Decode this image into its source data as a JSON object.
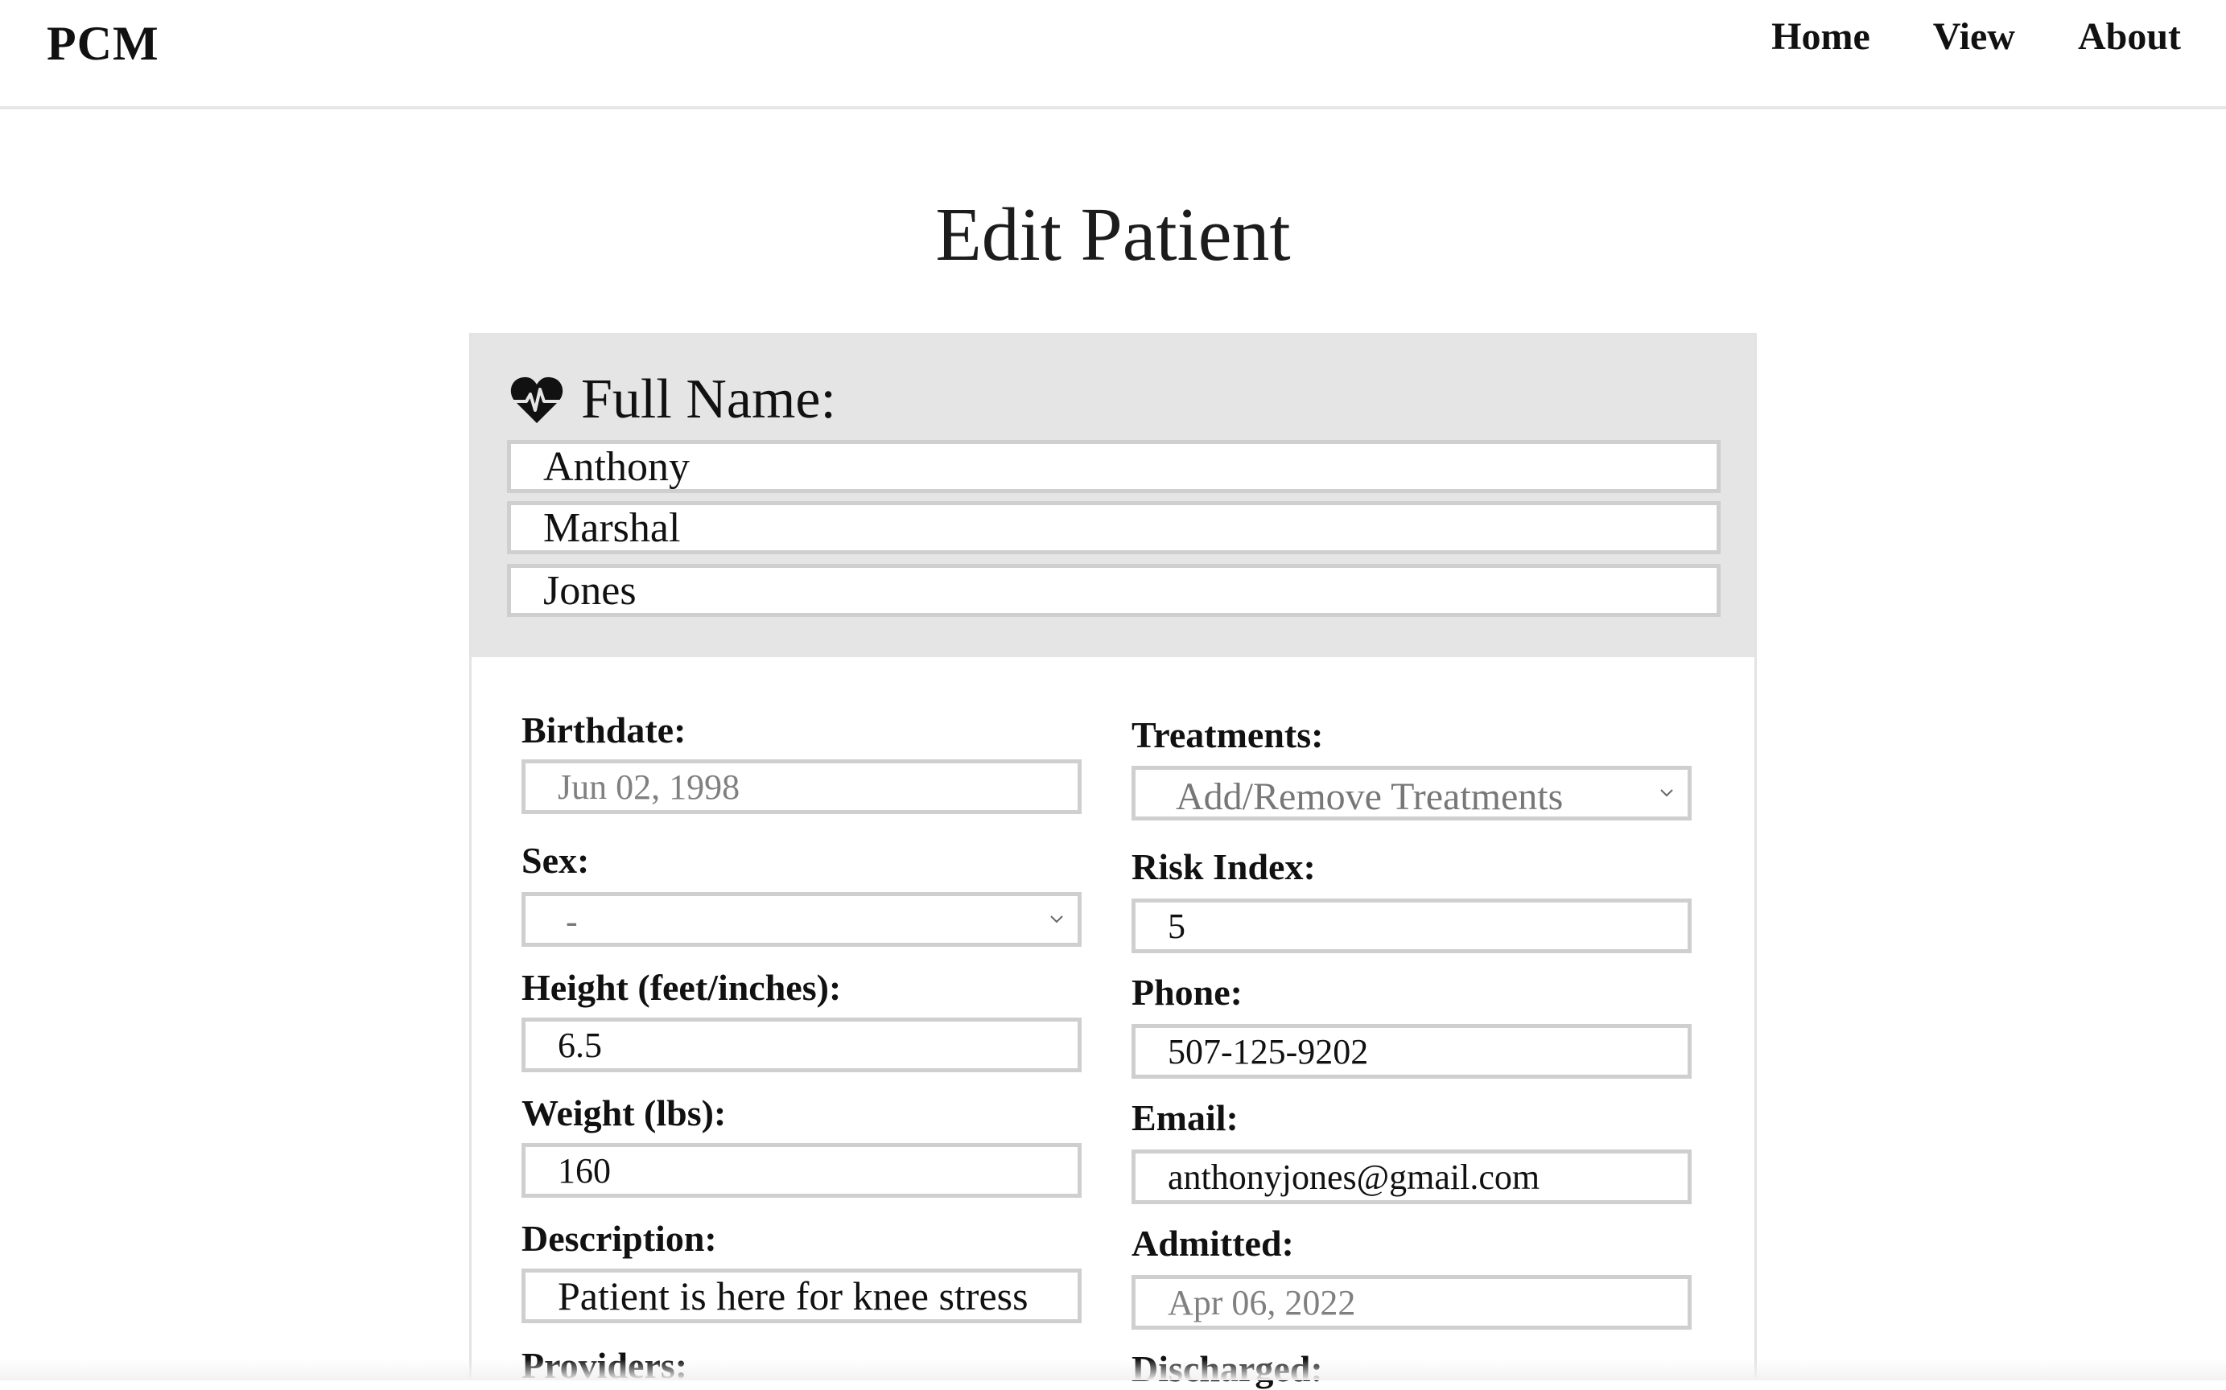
{
  "app": {
    "brand": "PCM"
  },
  "nav": {
    "home": "Home",
    "view": "View",
    "about": "About"
  },
  "page": {
    "title": "Edit Patient"
  },
  "full_name": {
    "label": "Full Name:",
    "first": "Anthony",
    "middle": "Marshal",
    "last": "Jones"
  },
  "left_fields": {
    "birthdate_label": "Birthdate:",
    "birthdate_value": "Jun 02, 1998",
    "sex_label": "Sex:",
    "sex_value": "-",
    "height_label": "Height (feet/inches):",
    "height_value": "6.5",
    "weight_label": "Weight (lbs):",
    "weight_value": "160",
    "description_label": "Description:",
    "description_value": "Patient is here for knee stress",
    "providers_label": "Providers:"
  },
  "right_fields": {
    "treatments_label": "Treatments:",
    "treatments_value": "Add/Remove Treatments",
    "risk_label": "Risk Index:",
    "risk_value": "5",
    "phone_label": "Phone:",
    "phone_value": "507-125-9202",
    "email_label": "Email:",
    "email_value": "anthonyjones@gmail.com",
    "admitted_label": "Admitted:",
    "admitted_value": "Apr 06, 2022",
    "discharged_label": "Discharged:"
  },
  "icons": {
    "name_section": "heart-pulse-icon",
    "select": "chevron-down-icon"
  },
  "colors": {
    "header_bg": "#e5e5e5",
    "border": "#cfcfcf",
    "text": "#111111",
    "placeholder": "#808080"
  }
}
